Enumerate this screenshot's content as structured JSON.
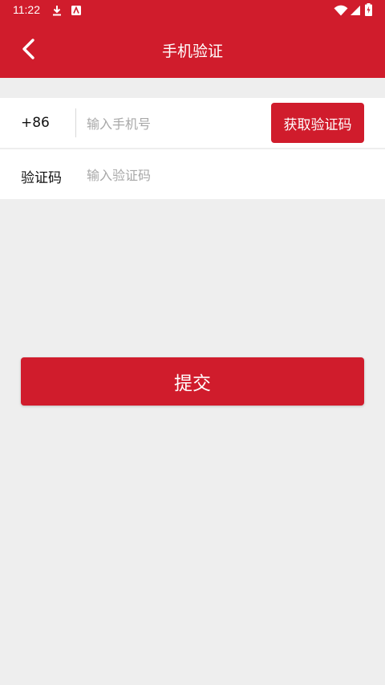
{
  "status_bar": {
    "time": "11:22",
    "icons": [
      "download-icon",
      "notification-icon",
      "wifi-icon",
      "signal-icon",
      "battery-icon"
    ]
  },
  "header": {
    "title": "手机验证",
    "back_icon": "chevron-left-icon"
  },
  "phone_row": {
    "country_code": "+86",
    "placeholder": "输入手机号",
    "get_code_label": "获取验证码"
  },
  "code_row": {
    "label": "验证码",
    "placeholder": "输入验证码"
  },
  "submit_label": "提交",
  "colors": {
    "brand": "#d01c2c",
    "background": "#eeeeee"
  }
}
